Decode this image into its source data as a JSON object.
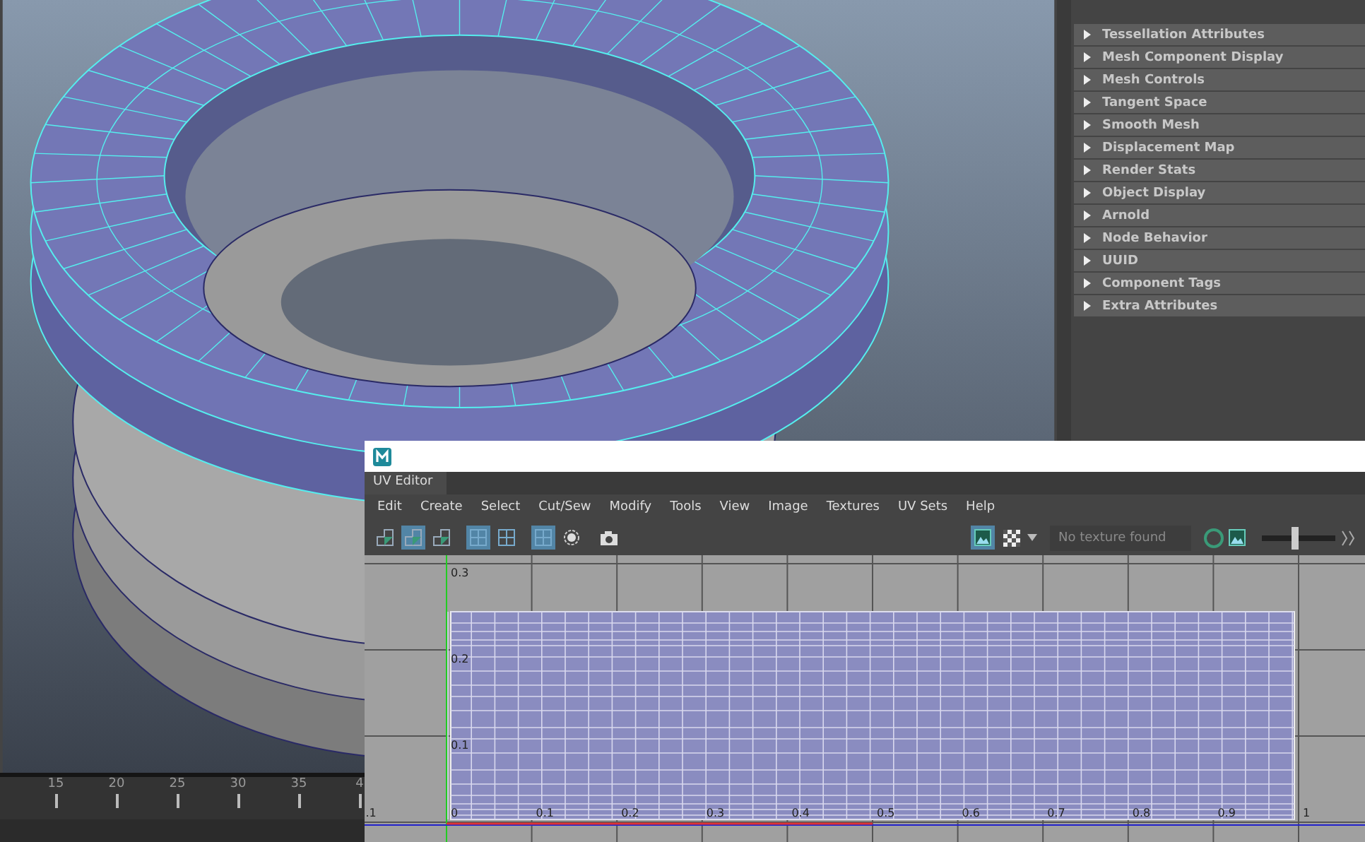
{
  "attribute_editor": {
    "sections": [
      {
        "label": "Tessellation Attributes",
        "expanded": false
      },
      {
        "label": "Mesh Component Display",
        "expanded": false
      },
      {
        "label": "Mesh Controls",
        "expanded": false
      },
      {
        "label": "Tangent Space",
        "expanded": false
      },
      {
        "label": "Smooth Mesh",
        "expanded": false
      },
      {
        "label": "Displacement Map",
        "expanded": false
      },
      {
        "label": "Render Stats",
        "expanded": false
      },
      {
        "label": "Object Display",
        "expanded": false
      },
      {
        "label": "Arnold",
        "expanded": false
      },
      {
        "label": "Node Behavior",
        "expanded": false
      },
      {
        "label": "UUID",
        "expanded": false
      },
      {
        "label": "Component Tags",
        "expanded": false
      },
      {
        "label": "Extra Attributes",
        "expanded": false
      }
    ]
  },
  "timeline": {
    "ticks": [
      "15",
      "20",
      "25",
      "30",
      "35",
      "4"
    ]
  },
  "uv_editor": {
    "tab": "UV Editor",
    "menu": [
      "Edit",
      "Create",
      "Select",
      "Cut/Sew",
      "Modify",
      "Tools",
      "View",
      "Image",
      "Textures",
      "UV Sets",
      "Help"
    ],
    "tools": [
      {
        "kind": "uv-shell",
        "selected": false
      },
      {
        "kind": "uv-shell",
        "selected": true
      },
      {
        "kind": "uv-shell",
        "selected": false
      },
      {
        "kind": "grid",
        "selected": true
      },
      {
        "kind": "grid",
        "selected": false
      },
      {
        "kind": "grid",
        "selected": true
      },
      {
        "kind": "circle",
        "selected": false
      },
      {
        "kind": "camera",
        "selected": false
      }
    ],
    "right_tools": [
      {
        "kind": "image",
        "selected": true
      },
      {
        "kind": "checker",
        "selected": false
      }
    ],
    "texture_field": {
      "placeholder": "No texture found"
    },
    "exposure": {
      "level": 0.45
    },
    "u_labels": [
      ".1",
      "0",
      "0.1",
      "0.2",
      "0.3",
      "0.4",
      "0.5",
      "0.6",
      "0.7",
      "0.8",
      "0.9",
      "1"
    ],
    "v_labels": [
      "0.3",
      "0.2",
      "0.1"
    ]
  }
}
